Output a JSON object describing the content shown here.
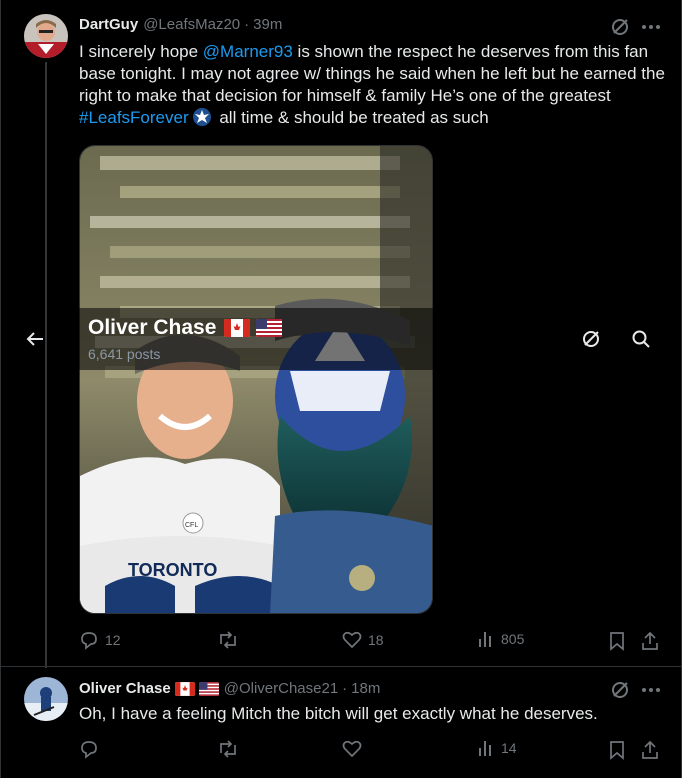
{
  "tweet1": {
    "name": "DartGuy",
    "handle": "@LeafsMaz20",
    "time": "39m",
    "text_parts": {
      "a": "I sincerely hope ",
      "mention": "@Marner93",
      "b": " is shown the respect he deserves from this fan base tonight. I may not agree w/ things he said when he left but he earned the right to make that decision for himself & family He’s one of the greatest ",
      "hashtag": "#LeafsForever",
      "c": " all time & should be treated as such"
    },
    "media": {
      "jersey_text": "TORONTO",
      "jersey_patch": "CFL"
    },
    "stats": {
      "replies": "12",
      "reposts": "",
      "likes": "18",
      "views": "805"
    }
  },
  "overlay": {
    "name": "Oliver Chase",
    "posts": "6,641 posts"
  },
  "tweet2": {
    "name": "Oliver Chase",
    "handle": "@OliverChase21",
    "time": "18m",
    "text": "Oh, I have a feeling Mitch the bitch will get exactly what he deserves.",
    "stats": {
      "replies": "",
      "reposts": "",
      "likes": "",
      "views": "14"
    }
  },
  "icons": {
    "grok": "grok-icon",
    "more": "more-icon",
    "back": "back-arrow-icon",
    "search": "search-icon",
    "reply": "reply-icon",
    "repost": "repost-icon",
    "like": "like-icon",
    "views": "views-icon",
    "bookmark": "bookmark-icon",
    "share": "share-icon"
  },
  "colors": {
    "background": "#000000",
    "link": "#1d9bf0",
    "muted": "#71767b",
    "text": "#e7e9ea"
  }
}
